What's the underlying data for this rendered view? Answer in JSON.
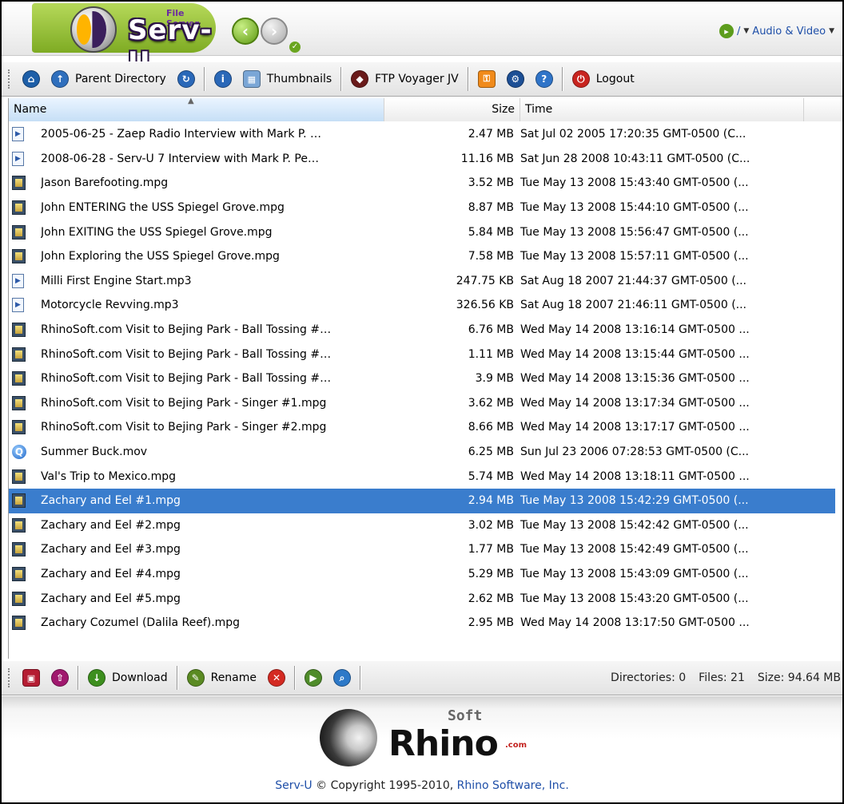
{
  "header": {
    "logo_small": "File Server",
    "logo_title": "Serv-U",
    "path_label": "/",
    "folder_label": "Audio & Video"
  },
  "toolbar": {
    "parent_directory": "Parent Directory",
    "thumbnails": "Thumbnails",
    "ftp_voyager": "FTP Voyager JV",
    "logout": "Logout"
  },
  "columns": {
    "name": "Name",
    "size": "Size",
    "time": "Time"
  },
  "files": [
    {
      "name": "2005-06-25 - Zaep Radio Interview with Mark P. …",
      "size": "2.47 MB",
      "time": "Sat Jul 02 2005 17:20:35 GMT-0500 (C...",
      "icon": "audio-file-icon"
    },
    {
      "name": "2008-06-28 - Serv-U 7 Interview with Mark P. Pe…",
      "size": "11.16 MB",
      "time": "Sat Jun 28 2008 10:43:11 GMT-0500 (C...",
      "icon": "audio-file-icon"
    },
    {
      "name": "Jason Barefooting.mpg",
      "size": "3.52 MB",
      "time": "Tue May 13 2008 15:43:40 GMT-0500 (...",
      "icon": "video-file-icon"
    },
    {
      "name": "John ENTERING the USS Spiegel Grove.mpg",
      "size": "8.87 MB",
      "time": "Tue May 13 2008 15:44:10 GMT-0500 (...",
      "icon": "video-file-icon"
    },
    {
      "name": "John EXITING the USS Spiegel Grove.mpg",
      "size": "5.84 MB",
      "time": "Tue May 13 2008 15:56:47 GMT-0500 (...",
      "icon": "video-file-icon"
    },
    {
      "name": "John Exploring the USS Spiegel Grove.mpg",
      "size": "7.58 MB",
      "time": "Tue May 13 2008 15:57:11 GMT-0500 (...",
      "icon": "video-file-icon"
    },
    {
      "name": "Milli First Engine Start.mp3",
      "size": "247.75 KB",
      "time": "Sat Aug 18 2007 21:44:37 GMT-0500 (...",
      "icon": "audio-file-icon"
    },
    {
      "name": "Motorcycle Revving.mp3",
      "size": "326.56 KB",
      "time": "Sat Aug 18 2007 21:46:11 GMT-0500 (...",
      "icon": "audio-file-icon"
    },
    {
      "name": "RhinoSoft.com Visit to Bejing Park - Ball Tossing #…",
      "size": "6.76 MB",
      "time": "Wed May 14 2008 13:16:14 GMT-0500 ...",
      "icon": "video-file-icon"
    },
    {
      "name": "RhinoSoft.com Visit to Bejing Park - Ball Tossing #…",
      "size": "1.11 MB",
      "time": "Wed May 14 2008 13:15:44 GMT-0500 ...",
      "icon": "video-file-icon"
    },
    {
      "name": "RhinoSoft.com Visit to Bejing Park - Ball Tossing #…",
      "size": "3.9 MB",
      "time": "Wed May 14 2008 13:15:36 GMT-0500 ...",
      "icon": "video-file-icon"
    },
    {
      "name": "RhinoSoft.com Visit to Bejing Park - Singer #1.mpg",
      "size": "3.62 MB",
      "time": "Wed May 14 2008 13:17:34 GMT-0500 ...",
      "icon": "video-file-icon"
    },
    {
      "name": "RhinoSoft.com Visit to Bejing Park - Singer #2.mpg",
      "size": "8.66 MB",
      "time": "Wed May 14 2008 13:17:17 GMT-0500 ...",
      "icon": "video-file-icon"
    },
    {
      "name": "Summer Buck.mov",
      "size": "6.25 MB",
      "time": "Sun Jul 23 2006 07:28:53 GMT-0500 (C...",
      "icon": "quicktime-file-icon"
    },
    {
      "name": "Val's Trip to Mexico.mpg",
      "size": "5.74 MB",
      "time": "Wed May 14 2008 13:18:11 GMT-0500 ...",
      "icon": "video-file-icon"
    },
    {
      "name": "Zachary and Eel #1.mpg",
      "size": "2.94 MB",
      "time": "Tue May 13 2008 15:42:29 GMT-0500 (...",
      "icon": "video-file-icon",
      "selected": true
    },
    {
      "name": "Zachary and Eel #2.mpg",
      "size": "3.02 MB",
      "time": "Tue May 13 2008 15:42:42 GMT-0500 (...",
      "icon": "video-file-icon"
    },
    {
      "name": "Zachary and Eel #3.mpg",
      "size": "1.77 MB",
      "time": "Tue May 13 2008 15:42:49 GMT-0500 (...",
      "icon": "video-file-icon"
    },
    {
      "name": "Zachary and Eel #4.mpg",
      "size": "5.29 MB",
      "time": "Tue May 13 2008 15:43:09 GMT-0500 (...",
      "icon": "video-file-icon"
    },
    {
      "name": "Zachary and Eel #5.mpg",
      "size": "2.62 MB",
      "time": "Tue May 13 2008 15:43:20 GMT-0500 (...",
      "icon": "video-file-icon"
    },
    {
      "name": "Zachary Cozumel (Dalila Reef).mpg",
      "size": "2.95 MB",
      "time": "Wed May 14 2008 13:17:50 GMT-0500 ...",
      "icon": "video-file-icon"
    }
  ],
  "bottom_toolbar": {
    "download": "Download",
    "rename": "Rename"
  },
  "status": {
    "directories": "Directories: 0",
    "files": "Files: 21",
    "size": "Size: 94.64 MB"
  },
  "footer": {
    "brand_soft": "Soft",
    "brand_main": "Rhino",
    "brand_com": ".com",
    "copyright_product": "Serv-U",
    "copyright_text": " © Copyright 1995-2010, ",
    "copyright_company": "Rhino Software, Inc."
  },
  "colors": {
    "selection": "#3a7dcd",
    "link": "#1f4fa8",
    "brand_green": "#7eab23"
  }
}
